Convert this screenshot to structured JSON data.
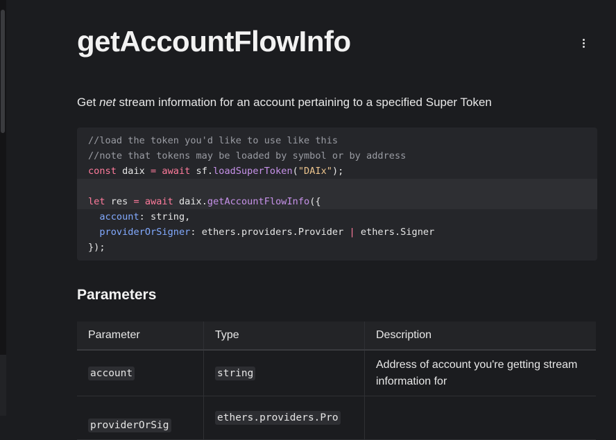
{
  "page": {
    "title": "getAccountFlowInfo",
    "intro_before": "Get ",
    "intro_em": "net",
    "intro_after": " stream information for an account pertaining to a specified Super Token"
  },
  "code": {
    "comment1": "//load the token you'd like to use like this",
    "comment2": "//note that tokens may be loaded by symbol or by address",
    "l3_const": "const",
    "l3_a": " daix ",
    "l3_eq": "=",
    "l3_sp": " ",
    "l3_await": "await",
    "l3_b": " sf.",
    "l3_fn": "loadSuperToken",
    "l3_c": "(",
    "l3_str": "\"DAIx\"",
    "l3_d": ");",
    "l5_let": "let",
    "l5_a": " res ",
    "l5_eq": "=",
    "l5_sp": " ",
    "l5_await": "await",
    "l5_b": " daix.",
    "l5_fn": "getAccountFlowInfo",
    "l5_c": "({",
    "l6_prop": "  account",
    "l6_rest": ": string,",
    "l7_prop": "  providerOrSigner",
    "l7_a": ": ethers.providers.Provider ",
    "l7_pipe": "|",
    "l7_b": " ethers.Signer",
    "l8": "});"
  },
  "params": {
    "heading": "Parameters",
    "columns": [
      "Parameter",
      "Type",
      "Description"
    ],
    "rows": [
      {
        "param": "account",
        "type": "string",
        "desc": "Address of account you're getting stream information for"
      },
      {
        "param": "providerOrSig",
        "type": "ethers.providers.Pro",
        "desc": ""
      }
    ]
  },
  "icons": {
    "menu": "more-vertical-icon"
  }
}
